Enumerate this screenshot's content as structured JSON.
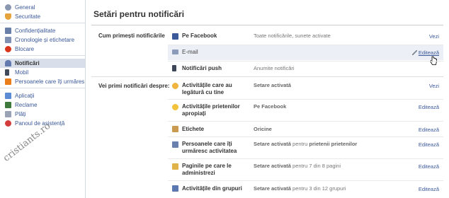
{
  "sidebar": {
    "groups": [
      {
        "items": [
          {
            "label": "General",
            "icon": "gear-icon"
          },
          {
            "label": "Securitate",
            "icon": "shield-icon"
          }
        ]
      },
      {
        "items": [
          {
            "label": "Confidențialitate",
            "icon": "lock-icon"
          },
          {
            "label": "Cronologie și etichetare",
            "icon": "timeline-icon"
          },
          {
            "label": "Blocare",
            "icon": "block-icon"
          }
        ]
      },
      {
        "items": [
          {
            "label": "Notificări",
            "icon": "bell-icon"
          },
          {
            "label": "Mobil",
            "icon": "mobile-icon"
          },
          {
            "label": "Persoanele care îți urmăres...",
            "icon": "rss-icon"
          }
        ]
      },
      {
        "items": [
          {
            "label": "Aplicații",
            "icon": "apps-icon"
          },
          {
            "label": "Reclame",
            "icon": "ads-icon"
          },
          {
            "label": "Plăți",
            "icon": "payments-icon"
          },
          {
            "label": "Panoul de asistență",
            "icon": "help-icon"
          }
        ]
      }
    ],
    "active": "Notificări"
  },
  "main": {
    "title": "Setări pentru notificări",
    "how_label": "Cum primești notificările",
    "what_label": "Vei primi notificări despre:",
    "how_rows": [
      {
        "label": "Pe Facebook",
        "value": "Toate notificările, sunete activate",
        "link": "Vezi"
      },
      {
        "label": "E-mail",
        "value": "",
        "link": "Editează"
      },
      {
        "label": "Notificări push",
        "value": "Anumite notificări",
        "link": ""
      }
    ],
    "what_rows": [
      {
        "label": "Activitățile care au legătură cu tine",
        "value_bold": "Setare activată",
        "value_rest": "",
        "link": "Vezi"
      },
      {
        "label": "Activitățile prietenilor apropiați",
        "value_bold": "Pe Facebook",
        "value_rest": "",
        "link": "Editează"
      },
      {
        "label": "Etichete",
        "value_bold": "Oricine",
        "value_rest": "",
        "link": "Editează"
      },
      {
        "label": "Persoanele care îți urmăresc activitatea",
        "value_bold": "Setare activată",
        "value_rest": " pentru ",
        "value_bold2": "prietenii prietenilor",
        "link": "Editează"
      },
      {
        "label": "Paginile pe care le administrezi",
        "value_bold": "Setare activată",
        "value_rest": " pentru 7 din 8 pagini",
        "link": "Editează"
      },
      {
        "label": "Activitățile din grupuri",
        "value_bold": "Setare activată",
        "value_rest": " pentru 3 din 12 grupuri",
        "link": "Editează"
      }
    ]
  },
  "watermark": "cristiants.ro",
  "colors": {
    "link": "#3b5998",
    "active_bg": "#d8dfea",
    "hover_row": "#eceff5"
  }
}
